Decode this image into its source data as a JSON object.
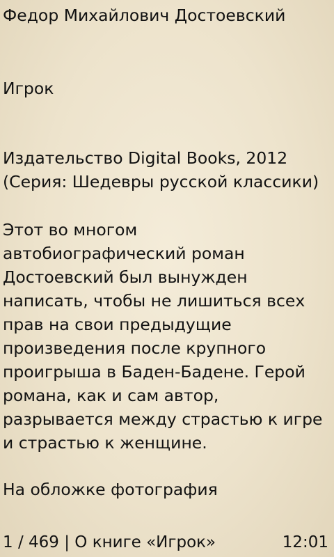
{
  "book": {
    "author": "Федор Михайлович Достоевский",
    "title": "Игрок",
    "publisher_line": "Издательство Digital Books, 2012",
    "series_line": "(Серия: Шедевры русской классики)",
    "annotation_lines": [
      "Этот во многом",
      "автобиографический роман",
      "Достоевский был вынужден",
      "написать, чтобы не лишиться всех",
      "прав на свои предыдущие",
      "произведения после крупного",
      "проигрыша в Баден-Бадене. Герой",
      "романа, как и сам автор,",
      "разрывается между страстью к игре",
      "и страстью к женщине."
    ],
    "cover_line": "На обложке фотография"
  },
  "status_bar": {
    "page_info": "1 / 469 | О книге «Игрок»",
    "clock": "12:01"
  }
}
